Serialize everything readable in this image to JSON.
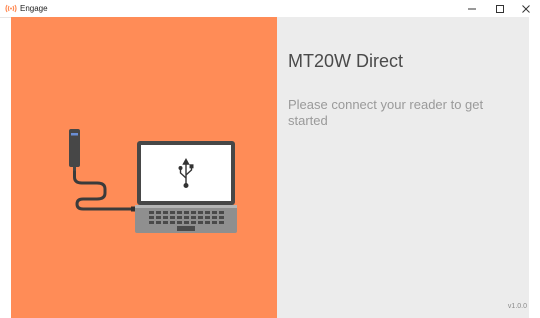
{
  "window": {
    "title": "Engage",
    "controls": {
      "minimize_icon": "minimize-icon",
      "maximize_icon": "maximize-icon",
      "close_icon": "close-icon"
    }
  },
  "colors": {
    "left_panel": "#ff8c57",
    "right_panel": "#ececec",
    "brand_icon": "#ff8c57",
    "heading_text": "#4a4a4a",
    "message_text": "#9a9a9a"
  },
  "main": {
    "heading": "MT20W Direct",
    "message": "Please connect your reader to get started",
    "version": "v1.0.0"
  },
  "illustration": {
    "icons": [
      "card-reader-icon",
      "laptop-icon",
      "usb-icon",
      "cable-icon"
    ]
  }
}
